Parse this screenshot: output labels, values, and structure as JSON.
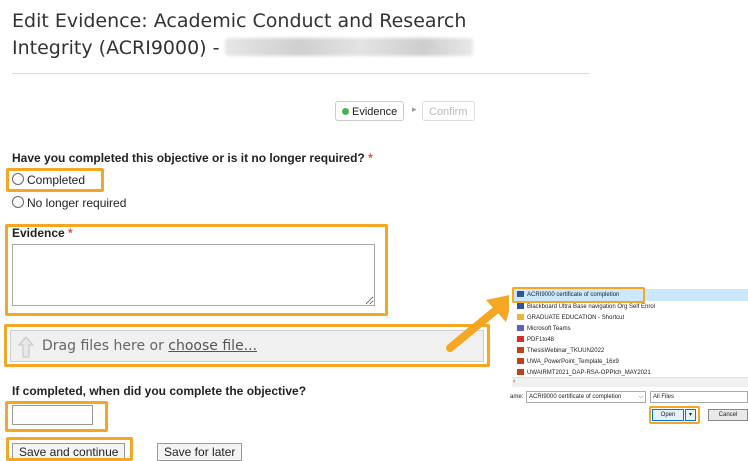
{
  "header": {
    "title_line1": "Edit Evidence: Academic Conduct and Research",
    "title_line2": "Integrity (ACRI9000) -"
  },
  "steps": {
    "evidence_label": "Evidence",
    "confirm_label": "Confirm",
    "separator": "▸"
  },
  "form": {
    "question_label": "Have you completed this objective or is it no longer required?",
    "required_mark": "*",
    "options": [
      "Completed",
      "No longer required"
    ],
    "evidence_label": "Evidence",
    "evidence_value": "",
    "dropzone_text": "Drag files here or ",
    "dropzone_link": "choose file...",
    "date_question": "If completed, when did you complete the objective?",
    "date_value": "",
    "save_continue_label": "Save and continue",
    "save_later_label": "Save for later"
  },
  "file_dialog": {
    "items": [
      {
        "name": "ACRI9000 certificate of completion",
        "icon": "file-doc-icon"
      },
      {
        "name": "Blackboard Ultra Base navigation Org Self Enrol",
        "icon": "file-doc-icon"
      },
      {
        "name": "GRADUATE EDUCATION - Shortcut",
        "icon": "folder-shortcut-icon"
      },
      {
        "name": "Microsoft Teams",
        "icon": "teams-icon"
      },
      {
        "name": "PDF1to48",
        "icon": "pdf-icon"
      },
      {
        "name": "ThesisWebinar_TKUUN2022",
        "icon": "ppt-icon"
      },
      {
        "name": "UWA_PowerPoint_Template_16x9",
        "icon": "ppt-icon"
      },
      {
        "name": "UWAIRMT2021_DAP-RSA-OPPtch_MAY2021",
        "icon": "ppt-icon"
      }
    ],
    "filename_label": "ame:",
    "filename_value": "ACRI9000 certificate of completion",
    "filter_value": "All Files",
    "open_label": "Open",
    "cancel_label": "Cancel"
  },
  "colors": {
    "highlight": "#f5a623",
    "required": "#d9534f",
    "active_dot": "#4caf50",
    "selected_row": "#cce8ff"
  }
}
